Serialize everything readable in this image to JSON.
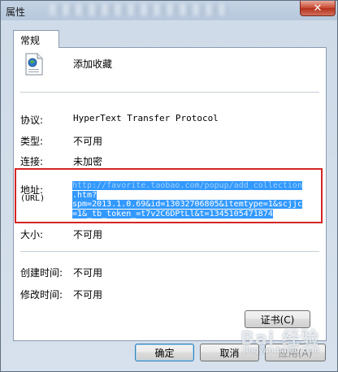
{
  "window": {
    "title": "属性",
    "close_label": "✕"
  },
  "tabs": [
    {
      "label": "常规"
    }
  ],
  "general": {
    "name": "添加收藏",
    "fields": {
      "protocol": {
        "label": "协议:",
        "value": "HyperText Transfer Protocol"
      },
      "type": {
        "label": "类型:",
        "value": "不可用"
      },
      "connection": {
        "label": "连接:",
        "value": "未加密"
      },
      "address": {
        "label": "地址:",
        "sublabel": "(URL)",
        "lines": [
          "http://favorite.taobao.com/popup/add_collection",
          ".htm?",
          "spm=2013.1.0.69&id=13032706805&itemtype=1&scjjc",
          "=1&_tb_token_=t7v2C6DPtLl&t=1345105471874"
        ]
      },
      "size": {
        "label": "大小:",
        "value": "不可用"
      },
      "created": {
        "label": "创建时间:",
        "value": "不可用"
      },
      "modified": {
        "label": "修改时间:",
        "value": "不可用"
      }
    },
    "certificate_button": "证书(C)"
  },
  "footer": {
    "ok_label": "确定",
    "cancel_label": "取消",
    "apply_label": "应用(A)"
  },
  "watermark": {
    "text": "Bai 经验",
    "sub": "jingyan.baidu.com"
  }
}
